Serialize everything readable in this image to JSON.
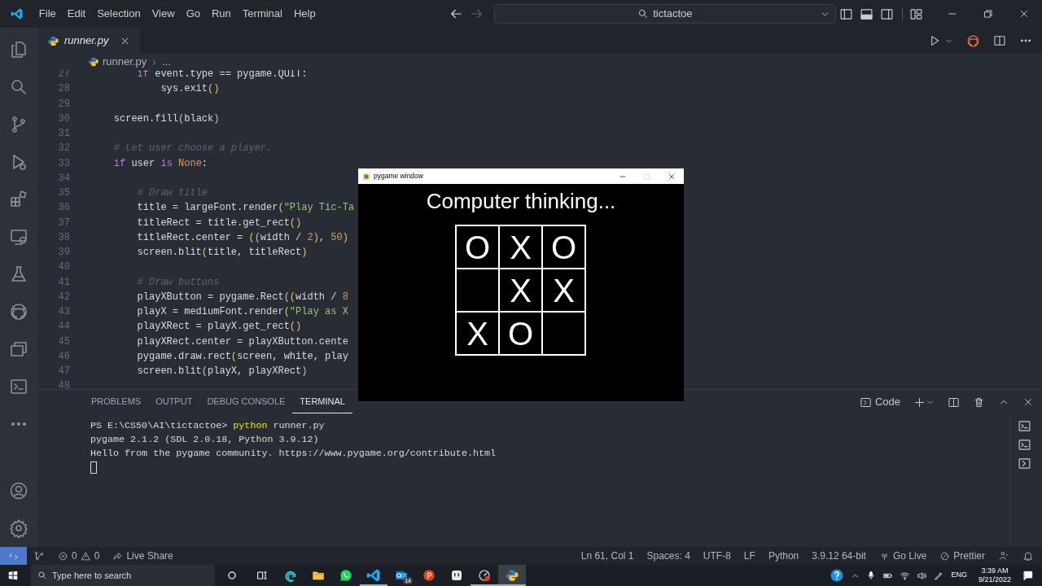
{
  "title_bar": {
    "menu": [
      "File",
      "Edit",
      "Selection",
      "View",
      "Go",
      "Run",
      "Terminal",
      "Help"
    ],
    "nav": [
      {
        "kind": "back",
        "disabled": false
      },
      {
        "kind": "forward",
        "disabled": true
      }
    ],
    "command_center": "tictactoe"
  },
  "editor": {
    "tabs": [
      {
        "label": "runner.py",
        "preview": true,
        "selected": true
      }
    ],
    "breadcrumb": [
      "runner.py",
      "..."
    ],
    "lines": [
      {
        "number": "27",
        "tokens": [
          {
            "text": "        if",
            "kind": "keyword"
          },
          {
            "text": " event.type == pygame.QUIT:",
            "kind": "plain"
          }
        ]
      },
      {
        "number": "28",
        "tokens": [
          {
            "text": "            sys.exit",
            "kind": "plain"
          },
          {
            "text": "()",
            "kind": "bracket"
          }
        ]
      },
      {
        "number": "29"
      },
      {
        "number": "30",
        "tokens": [
          {
            "text": "    screen.fill",
            "kind": "plain"
          },
          {
            "text": "(",
            "kind": "bracket"
          },
          {
            "text": "black",
            "kind": "plain"
          },
          {
            "text": ")",
            "kind": "bracket"
          }
        ]
      },
      {
        "number": "31"
      },
      {
        "number": "32",
        "tokens": [
          {
            "text": "    # Let user choose a player.",
            "kind": "comment"
          }
        ]
      },
      {
        "number": "33",
        "tokens": [
          {
            "text": "    if",
            "kind": "keyword"
          },
          {
            "text": " user ",
            "kind": "plain"
          },
          {
            "text": "is",
            "kind": "keyword"
          },
          {
            "text": " None",
            "kind": "constant"
          },
          {
            "text": ":",
            "kind": "plain"
          }
        ]
      },
      {
        "number": "34"
      },
      {
        "number": "35",
        "tokens": [
          {
            "text": "        # Draw title",
            "kind": "comment"
          }
        ]
      },
      {
        "number": "36",
        "tokens": [
          {
            "text": "        title = largeFont.render",
            "kind": "plain"
          },
          {
            "text": "(",
            "kind": "bracket"
          },
          {
            "text": "\"Play Tic-Ta",
            "kind": "string"
          }
        ]
      },
      {
        "number": "37",
        "tokens": [
          {
            "text": "        titleRect = title.get_rect",
            "kind": "plain"
          },
          {
            "text": "()",
            "kind": "bracket"
          }
        ]
      },
      {
        "number": "38",
        "tokens": [
          {
            "text": "        titleRect.center = ",
            "kind": "plain"
          },
          {
            "text": "((",
            "kind": "bracket"
          },
          {
            "text": "width / ",
            "kind": "plain"
          },
          {
            "text": "2",
            "kind": "constant"
          },
          {
            "text": ")",
            "kind": "bracket"
          },
          {
            "text": ", ",
            "kind": "plain"
          },
          {
            "text": "50",
            "kind": "constant"
          },
          {
            "text": ")",
            "kind": "bracket"
          }
        ]
      },
      {
        "number": "39",
        "tokens": [
          {
            "text": "        screen.blit",
            "kind": "plain"
          },
          {
            "text": "(",
            "kind": "bracket"
          },
          {
            "text": "title, titleRect",
            "kind": "plain"
          },
          {
            "text": ")",
            "kind": "bracket"
          }
        ]
      },
      {
        "number": "40"
      },
      {
        "number": "41",
        "tokens": [
          {
            "text": "        # Draw buttons",
            "kind": "comment"
          }
        ]
      },
      {
        "number": "42",
        "tokens": [
          {
            "text": "        playXButton = pygame.Rect",
            "kind": "plain"
          },
          {
            "text": "((",
            "kind": "bracket"
          },
          {
            "text": "width / ",
            "kind": "plain"
          },
          {
            "text": "8",
            "kind": "constant"
          }
        ]
      },
      {
        "number": "43",
        "tokens": [
          {
            "text": "        playX = mediumFont.render",
            "kind": "plain"
          },
          {
            "text": "(",
            "kind": "bracket"
          },
          {
            "text": "\"Play as X",
            "kind": "string"
          }
        ]
      },
      {
        "number": "44",
        "tokens": [
          {
            "text": "        playXRect = playX.get_rect",
            "kind": "plain"
          },
          {
            "text": "()",
            "kind": "bracket"
          }
        ]
      },
      {
        "number": "45",
        "tokens": [
          {
            "text": "        playXRect.center = playXButton.cente",
            "kind": "plain"
          }
        ]
      },
      {
        "number": "46",
        "tokens": [
          {
            "text": "        pygame.draw.rect",
            "kind": "plain"
          },
          {
            "text": "(",
            "kind": "bracket"
          },
          {
            "text": "screen, white, play",
            "kind": "plain"
          }
        ]
      },
      {
        "number": "47",
        "tokens": [
          {
            "text": "        screen.blit",
            "kind": "plain"
          },
          {
            "text": "(",
            "kind": "bracket"
          },
          {
            "text": "playX, playXRect",
            "kind": "plain"
          },
          {
            "text": ")",
            "kind": "bracket"
          }
        ]
      },
      {
        "number": "48"
      }
    ]
  },
  "pygame_window": {
    "title": "pygame window",
    "controls": [
      {
        "kind": "minimize",
        "disabled": false
      },
      {
        "kind": "maximize",
        "disabled": true
      },
      {
        "kind": "close",
        "disabled": false
      }
    ],
    "heading": "Computer thinking...",
    "board": [
      {
        "kind": "mark",
        "text": "O"
      },
      {
        "kind": "mark",
        "text": "X"
      },
      {
        "kind": "mark",
        "text": "O"
      },
      {
        "kind": "empty"
      },
      {
        "kind": "mark",
        "text": "X"
      },
      {
        "kind": "mark",
        "text": "X"
      },
      {
        "kind": "mark",
        "text": "X"
      },
      {
        "kind": "mark",
        "text": "O"
      },
      {
        "kind": "empty"
      }
    ]
  },
  "panel": {
    "tabs": [
      {
        "label": "PROBLEMS",
        "selected": false
      },
      {
        "label": "OUTPUT",
        "selected": false
      },
      {
        "label": "DEBUG CONSOLE",
        "selected": false
      },
      {
        "label": "TERMINAL",
        "selected": true
      }
    ],
    "terminal_name": "Code",
    "terminal_lines": [
      {
        "tokens": [
          {
            "text": "PS E:\\CS50\\AI\\tictactoe> ",
            "kind": "plain"
          },
          {
            "text": "python",
            "kind": "command"
          },
          {
            "text": " runner.py",
            "kind": "plain"
          }
        ]
      },
      {
        "tokens": [
          {
            "text": "pygame 2.1.2 (SDL 2.0.18, Python 3.9.12)",
            "kind": "plain"
          }
        ]
      },
      {
        "tokens": [
          {
            "text": "Hello from the pygame community. https://www.pygame.org/contribute.html",
            "kind": "plain"
          }
        ]
      }
    ],
    "cursor": true
  },
  "status_bar": {
    "errors": "0",
    "warnings": "0",
    "live_share": "Live Share",
    "items": [
      "Ln 61, Col 1",
      "Spaces: 4",
      "UTF-8",
      "LF",
      "Python",
      "3.9.12 64-bit"
    ],
    "go_live": "Go Live",
    "prettier": "Prettier"
  },
  "taskbar": {
    "search_placeholder": "Type here to search",
    "apps": [
      {
        "kind": "browser",
        "running": false,
        "selected": false
      },
      {
        "kind": "folder",
        "running": false,
        "selected": false
      },
      {
        "kind": "chat",
        "running": false,
        "selected": false
      },
      {
        "kind": "code",
        "running": true,
        "selected": false
      },
      {
        "kind": "mail",
        "running": false,
        "selected": false,
        "badge": "14"
      },
      {
        "kind": "slides",
        "running": false,
        "selected": false
      },
      {
        "kind": "square",
        "running": false,
        "selected": false
      },
      {
        "kind": "gauge",
        "running": true,
        "selected": false
      },
      {
        "kind": "snake",
        "running": true,
        "selected": true
      }
    ],
    "language": "ENG",
    "time": "3:39 AM",
    "date": "9/21/2022"
  }
}
